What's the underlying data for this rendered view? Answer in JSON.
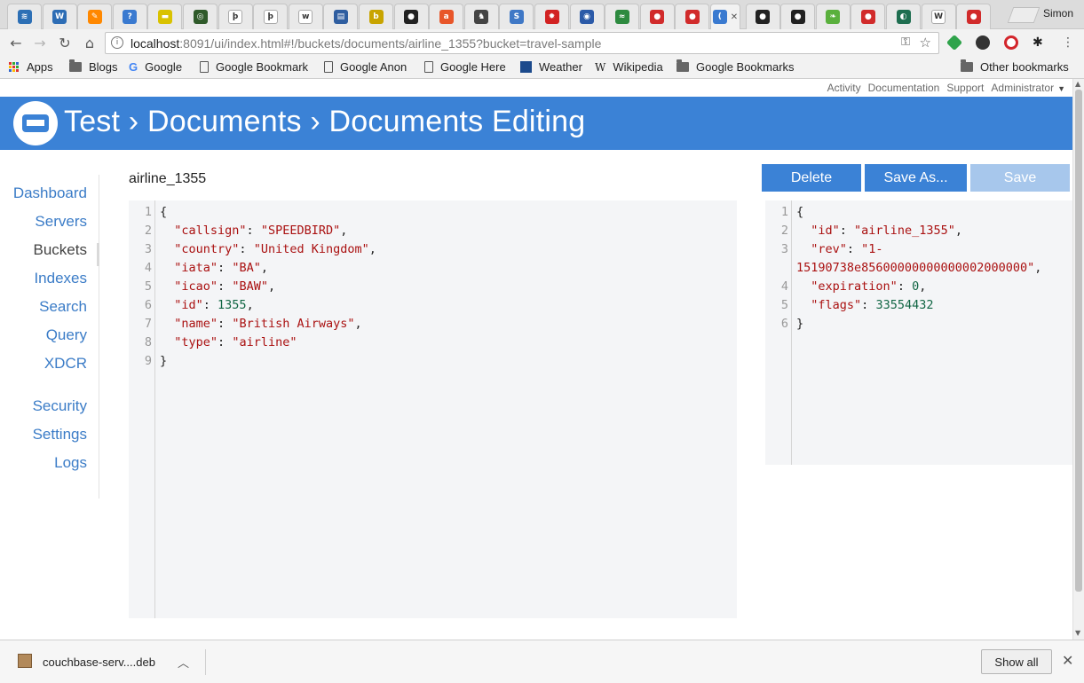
{
  "browser": {
    "profile_name": "Simon",
    "tab_favicons": [
      {
        "name": "tab-favicon-1",
        "color": "#2c6fb5",
        "glyph": "≋"
      },
      {
        "name": "tab-favicon-2",
        "color": "#2d6db5",
        "glyph": "W"
      },
      {
        "name": "tab-favicon-3",
        "color": "#ff8800",
        "glyph": "✎"
      },
      {
        "name": "tab-favicon-4",
        "color": "#3a7ad0",
        "glyph": "?"
      },
      {
        "name": "tab-favicon-5",
        "color": "#d9c200",
        "glyph": "▬"
      },
      {
        "name": "tab-favicon-6",
        "color": "#2f5a2a",
        "glyph": "◎"
      },
      {
        "name": "tab-favicon-7",
        "color": "#ffffff",
        "glyph": "þ"
      },
      {
        "name": "tab-favicon-8",
        "color": "#ffffff",
        "glyph": "þ"
      },
      {
        "name": "tab-favicon-9",
        "color": "#ffffff",
        "glyph": "w"
      },
      {
        "name": "tab-favicon-10",
        "color": "#2f5ea0",
        "glyph": "▤"
      },
      {
        "name": "tab-favicon-11",
        "color": "#c8a400",
        "glyph": "b"
      },
      {
        "name": "tab-favicon-12",
        "color": "#222222",
        "glyph": "●"
      },
      {
        "name": "tab-favicon-13",
        "color": "#e8562a",
        "glyph": "a"
      },
      {
        "name": "tab-favicon-14",
        "color": "#444444",
        "glyph": "♞"
      },
      {
        "name": "tab-favicon-15",
        "color": "#3f78c6",
        "glyph": "S"
      },
      {
        "name": "tab-favicon-16",
        "color": "#d22222",
        "glyph": "✹"
      },
      {
        "name": "tab-favicon-17",
        "color": "#2b5aa8",
        "glyph": "◉"
      },
      {
        "name": "tab-favicon-18",
        "color": "#2d8a3f",
        "glyph": "≈"
      },
      {
        "name": "tab-favicon-19",
        "color": "#d12b2b",
        "glyph": "●"
      },
      {
        "name": "tab-favicon-20",
        "color": "#d12b2b",
        "glyph": "●"
      },
      {
        "name": "tab-favicon-21",
        "color": "#3a7ad0",
        "glyph": "("
      },
      {
        "name": "tab-favicon-22",
        "color": "#222222",
        "glyph": "●"
      },
      {
        "name": "tab-favicon-23",
        "color": "#222222",
        "glyph": "●"
      },
      {
        "name": "tab-favicon-24",
        "color": "#5ab03d",
        "glyph": "❧"
      },
      {
        "name": "tab-favicon-25",
        "color": "#d12b2b",
        "glyph": "●"
      },
      {
        "name": "tab-favicon-26",
        "color": "#1e6e50",
        "glyph": "◐"
      },
      {
        "name": "tab-favicon-27",
        "color": "#ffffff",
        "glyph": "W"
      },
      {
        "name": "tab-favicon-28",
        "color": "#d12b2b",
        "glyph": "●"
      }
    ],
    "url_host": "localhost",
    "url_rest": ":8091/ui/index.html#!/buckets/documents/airline_1355?bucket=travel-sample",
    "bookmarks": [
      {
        "label": "Apps",
        "icon": "apps-grid-icon"
      },
      {
        "label": "Blogs",
        "icon": "folder-icon"
      },
      {
        "label": "Google",
        "icon": "google-icon"
      },
      {
        "label": "Google Bookmark",
        "icon": "page-icon"
      },
      {
        "label": "Google Anon",
        "icon": "page-icon"
      },
      {
        "label": "Google Here",
        "icon": "page-icon"
      },
      {
        "label": "Weather",
        "icon": "weather-icon"
      },
      {
        "label": "Wikipedia",
        "icon": "wikipedia-icon"
      },
      {
        "label": "Google Bookmarks",
        "icon": "folder-icon"
      }
    ],
    "other_bookmarks": "Other bookmarks"
  },
  "app": {
    "topnav": [
      "Activity",
      "Documentation",
      "Support",
      "Administrator"
    ],
    "banner_title": "Test › Documents › Documents Editing",
    "sidenav": [
      "Dashboard",
      "Servers",
      "Buckets",
      "Indexes",
      "Search",
      "Query",
      "XDCR",
      "Security",
      "Settings",
      "Logs"
    ],
    "active_nav": "Buckets",
    "doc_id": "airline_1355",
    "buttons": {
      "delete": "Delete",
      "save_as": "Save As...",
      "save": "Save"
    },
    "colors": {
      "brand_blue": "#3b82d6",
      "save_disabled": "#a7c7ec"
    }
  },
  "editor_left_lines": [
    [
      {
        "t": "{",
        "c": "p"
      }
    ],
    [
      {
        "t": "  ",
        "c": "p"
      },
      {
        "t": "\"callsign\"",
        "c": "k"
      },
      {
        "t": ": ",
        "c": "p"
      },
      {
        "t": "\"SPEEDBIRD\"",
        "c": "s"
      },
      {
        "t": ",",
        "c": "p"
      }
    ],
    [
      {
        "t": "  ",
        "c": "p"
      },
      {
        "t": "\"country\"",
        "c": "k"
      },
      {
        "t": ": ",
        "c": "p"
      },
      {
        "t": "\"United Kingdom\"",
        "c": "s"
      },
      {
        "t": ",",
        "c": "p"
      }
    ],
    [
      {
        "t": "  ",
        "c": "p"
      },
      {
        "t": "\"iata\"",
        "c": "k"
      },
      {
        "t": ": ",
        "c": "p"
      },
      {
        "t": "\"BA\"",
        "c": "s"
      },
      {
        "t": ",",
        "c": "p"
      }
    ],
    [
      {
        "t": "  ",
        "c": "p"
      },
      {
        "t": "\"icao\"",
        "c": "k"
      },
      {
        "t": ": ",
        "c": "p"
      },
      {
        "t": "\"BAW\"",
        "c": "s"
      },
      {
        "t": ",",
        "c": "p"
      }
    ],
    [
      {
        "t": "  ",
        "c": "p"
      },
      {
        "t": "\"id\"",
        "c": "k"
      },
      {
        "t": ": ",
        "c": "p"
      },
      {
        "t": "1355",
        "c": "n"
      },
      {
        "t": ",",
        "c": "p"
      }
    ],
    [
      {
        "t": "  ",
        "c": "p"
      },
      {
        "t": "\"name\"",
        "c": "k"
      },
      {
        "t": ": ",
        "c": "p"
      },
      {
        "t": "\"British Airways\"",
        "c": "s"
      },
      {
        "t": ",",
        "c": "p"
      }
    ],
    [
      {
        "t": "  ",
        "c": "p"
      },
      {
        "t": "\"type\"",
        "c": "k"
      },
      {
        "t": ": ",
        "c": "p"
      },
      {
        "t": "\"airline\"",
        "c": "s"
      }
    ],
    [
      {
        "t": "}",
        "c": "p"
      }
    ]
  ],
  "editor_right_lines": [
    {
      "ln": "1",
      "parts": [
        {
          "t": "{",
          "c": "p"
        }
      ]
    },
    {
      "ln": "2",
      "parts": [
        {
          "t": "  ",
          "c": "p"
        },
        {
          "t": "\"id\"",
          "c": "k"
        },
        {
          "t": ": ",
          "c": "p"
        },
        {
          "t": "\"airline_1355\"",
          "c": "s"
        },
        {
          "t": ",",
          "c": "p"
        }
      ]
    },
    {
      "ln": "3",
      "parts": [
        {
          "t": "  ",
          "c": "p"
        },
        {
          "t": "\"rev\"",
          "c": "k"
        },
        {
          "t": ": ",
          "c": "p"
        },
        {
          "t": "\"1-",
          "c": "s"
        }
      ]
    },
    {
      "ln": "",
      "parts": [
        {
          "t": "15190738e85600000000000002000000\"",
          "c": "s"
        },
        {
          "t": ",",
          "c": "p"
        }
      ]
    },
    {
      "ln": "4",
      "parts": [
        {
          "t": "  ",
          "c": "p"
        },
        {
          "t": "\"expiration\"",
          "c": "k"
        },
        {
          "t": ": ",
          "c": "p"
        },
        {
          "t": "0",
          "c": "n"
        },
        {
          "t": ",",
          "c": "p"
        }
      ]
    },
    {
      "ln": "5",
      "parts": [
        {
          "t": "  ",
          "c": "p"
        },
        {
          "t": "\"flags\"",
          "c": "k"
        },
        {
          "t": ": ",
          "c": "p"
        },
        {
          "t": "33554432",
          "c": "n"
        }
      ]
    },
    {
      "ln": "6",
      "parts": [
        {
          "t": "}",
          "c": "p"
        }
      ]
    }
  ],
  "download": {
    "filename": "couchbase-serv....deb",
    "show_all": "Show all"
  }
}
